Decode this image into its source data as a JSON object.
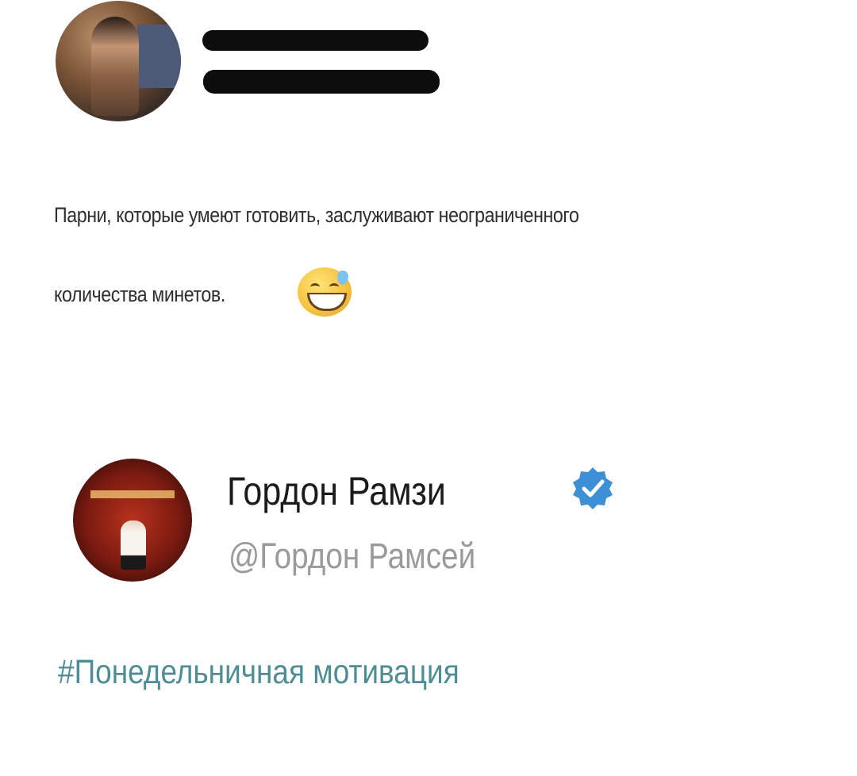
{
  "post1": {
    "avatar": "user-avatar-photo",
    "text_line1": "Парни, которые умеют готовить, заслуживают неограниченного",
    "text_line2": "количества минетов.",
    "emoji": "grinning-sweat-emoji"
  },
  "post2": {
    "avatar": "gordon-avatar-photo",
    "name": "Гордон Рамзи",
    "handle": "@Гордон Рамсей",
    "verified_icon": "verified-badge-icon",
    "hashtag": "#Понедельничная мотивация"
  },
  "colors": {
    "text": "#2f2f2f",
    "handle": "#9a9a9a",
    "hashtag": "#4f8d95",
    "verified": "#3d8fd6"
  }
}
